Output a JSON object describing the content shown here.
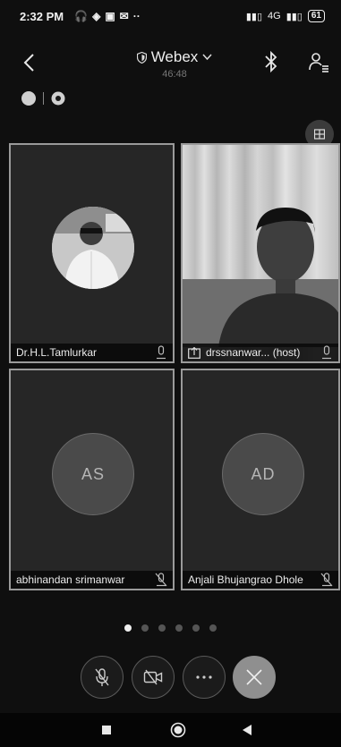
{
  "status_bar": {
    "time": "2:32 PM",
    "network": "4G",
    "battery": "61"
  },
  "header": {
    "title": "Webex",
    "timer": "46:48"
  },
  "participants": [
    {
      "name": "Dr.H.L.Tamlurkar",
      "type": "photo",
      "mic": "on"
    },
    {
      "name": "drssnanwar... (host)",
      "type": "video",
      "mic": "on",
      "sharing": true
    },
    {
      "name": "abhinandan srimanwar",
      "type": "initials",
      "initials": "AS",
      "mic": "muted"
    },
    {
      "name": "Anjali Bhujangrao Dhole",
      "type": "initials",
      "initials": "AD",
      "mic": "muted"
    }
  ],
  "pager": {
    "pages": 6,
    "current": 1
  },
  "controls": {
    "mute": "mic-off-icon",
    "video": "video-off-icon",
    "more": "more-icon",
    "end": "close-icon"
  },
  "nav_bar": [
    "recents-icon",
    "home-icon",
    "back-icon"
  ]
}
